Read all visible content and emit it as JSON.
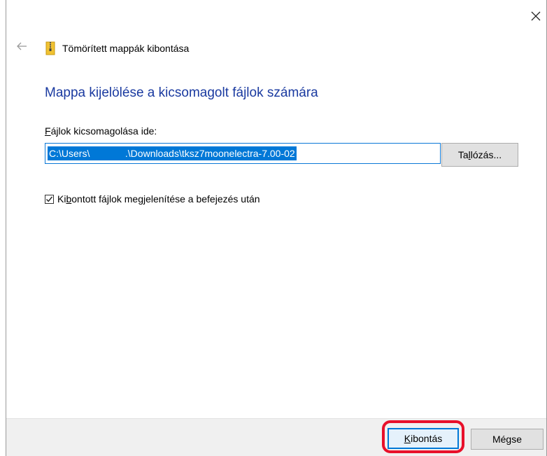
{
  "window": {
    "close_glyph": "✕",
    "back_glyph": "←"
  },
  "header": {
    "title": "Tömörített mappák kibontása",
    "icon": "zip-folder-icon"
  },
  "main": {
    "heading": "Mappa kijelölése a kicsomagolt fájlok számára",
    "field_label_first": "F",
    "field_label_rest": "ájlok kicsomagolása ide:",
    "path_value": "C:\\Users\\             .\\Downloads\\tksz7moonelectra-7.00-02",
    "browse_label_pre": "Ta",
    "browse_label_u": "l",
    "browse_label_post": "lózás...",
    "checkbox_checked": true,
    "checkbox_label_pre": "Ki",
    "checkbox_label_u": "b",
    "checkbox_label_post": "ontott fájlok megjelenítése a befejezés után"
  },
  "footer": {
    "extract_label_u": "K",
    "extract_label_rest": "ibontás",
    "cancel_label": "Mégse"
  },
  "colors": {
    "heading": "#1a3aa0",
    "selection": "#0078d7",
    "highlight": "#e8102a"
  }
}
